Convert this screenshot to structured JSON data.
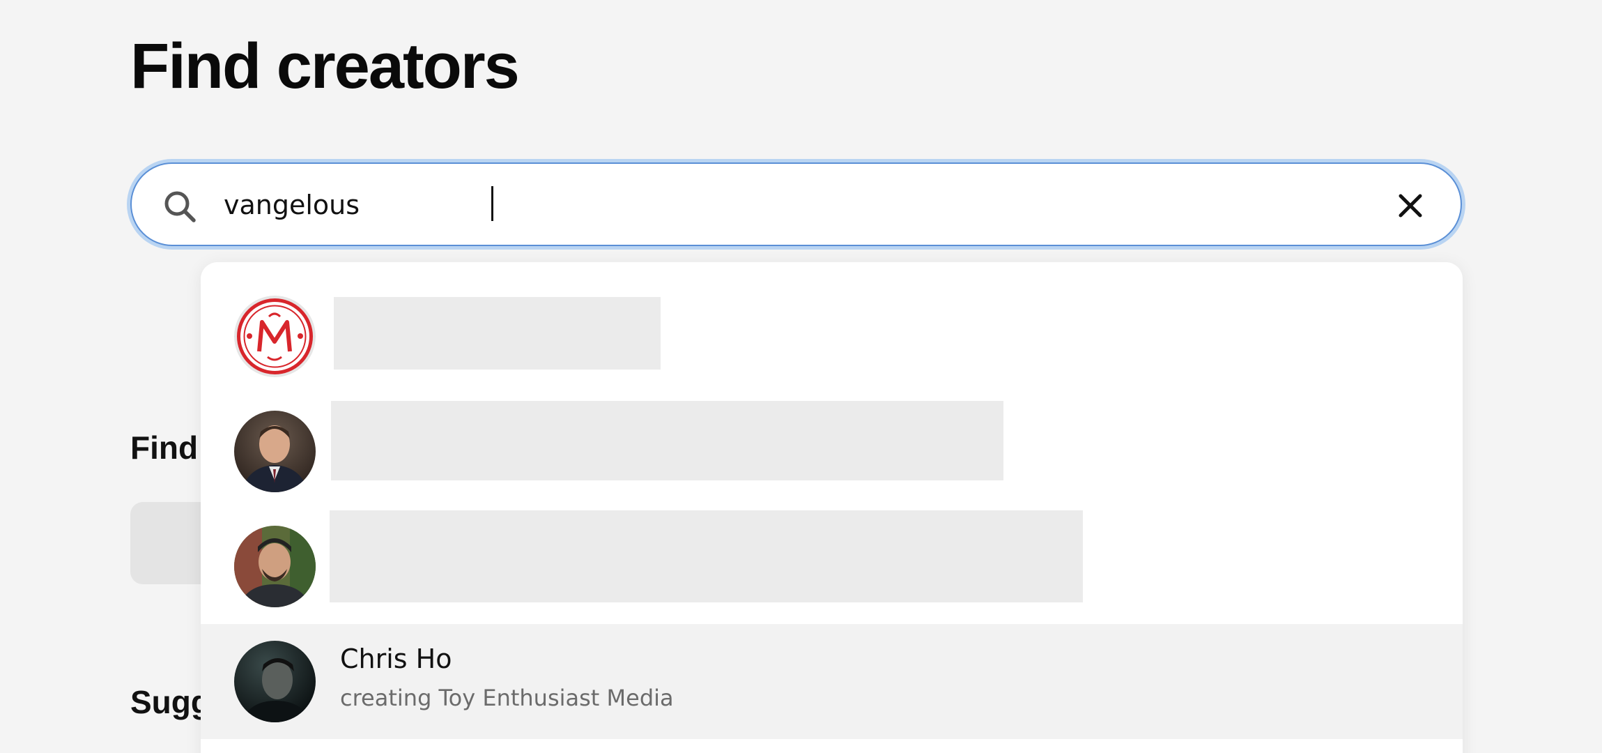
{
  "page": {
    "title": "Find creators"
  },
  "search": {
    "value": "vangelous",
    "clear_label": "Clear search"
  },
  "background": {
    "find_heading": "Find",
    "suggested_heading": "Sugg"
  },
  "results": [
    {
      "avatar": "red-monogram-logo",
      "name": "",
      "description": ""
    },
    {
      "avatar": "man-in-suit-photo",
      "name": "",
      "description": ""
    },
    {
      "avatar": "man-in-cap-photo",
      "name": "",
      "description": ""
    },
    {
      "avatar": "dark-portrait-photo",
      "name": "Chris Ho",
      "description": "creating Toy Enthusiast Media"
    }
  ],
  "colors": {
    "background": "#f4f4f4",
    "search_focus_ring": "#b9d4f2",
    "placeholder": "#ebebeb",
    "highlight_row": "#f2f2f2",
    "secondary_text": "#6b6b6b"
  }
}
